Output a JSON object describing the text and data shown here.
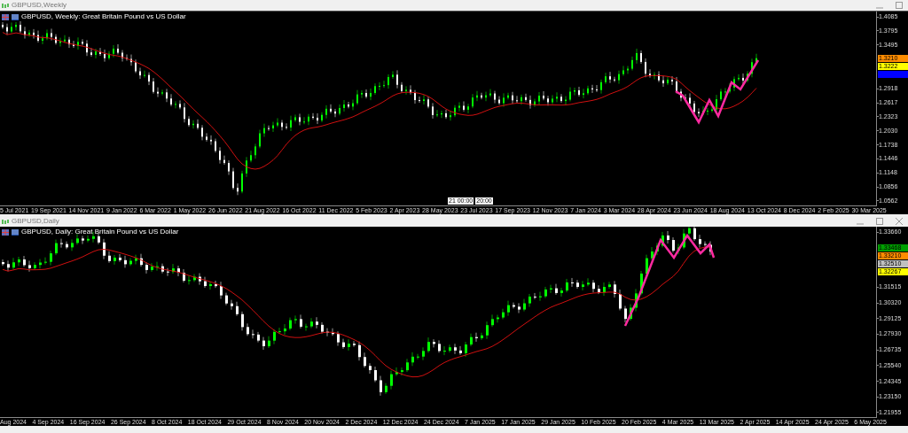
{
  "windows": [
    {
      "title": "GBPUSD,Weekly",
      "chart_title": "GBPUSD, Weekly:  Great Britain Pound vs US Dollar",
      "price_ticks": [
        "1.4085",
        "1.3795",
        "1.3495",
        "1.2918",
        "1.2617",
        "1.2323",
        "1.2030",
        "1.1738",
        "1.1446",
        "1.1148",
        "1.0856",
        "1.0562"
      ],
      "price_markers": [
        {
          "label": "1.3210",
          "color": "#ff8c00"
        },
        {
          "label": "1.3222",
          "color": "#ffff00"
        },
        {
          "color": "#0000ff"
        }
      ],
      "dates": [
        "5 Jul 2021",
        "19 Sep 2021",
        "14 Nov 2021",
        "9 Jan 2022",
        "6 Mar 2022",
        "1 May 2022",
        "26 Jun 2022",
        "21 Aug 2022",
        "16 Oct 2022",
        "11 Dec 2022",
        "5 Feb 2023",
        "2 Apr 2023",
        "28 May 2023",
        "23 Jul 2023",
        "17 Sep 2023",
        "12 Nov 2023",
        "7 Jan 2024",
        "3 Mar 2024",
        "28 Apr 2024",
        "23 Jun 2024",
        "18 Aug 2024",
        "13 Oct 2024",
        "8 Dec 2024",
        "2 Feb 2025",
        "30 Mar 2025"
      ],
      "crosshair_labels": [
        "21 00:00",
        "20:00"
      ]
    },
    {
      "title": "GBPUSD,Daily",
      "chart_title": "GBPUSD, Daily:  Great Britain Pound vs US Dollar",
      "price_ticks": [
        "1.33660",
        "1.31515",
        "1.30320",
        "1.29125",
        "1.27930",
        "1.26735",
        "1.25540",
        "1.24345",
        "1.23150",
        "1.21955"
      ],
      "price_markers": [
        {
          "label": "1.33468",
          "color": "#00a000"
        },
        {
          "label": "1.33210",
          "color": "#ff8c00"
        },
        {
          "label": "1.32510",
          "color": "#c0c0c0"
        },
        {
          "label": "1.32267",
          "color": "#ffff00"
        }
      ],
      "dates": [
        "Aug 2024",
        "4 Sep 2024",
        "16 Sep 2024",
        "26 Sep 2024",
        "8 Oct 2024",
        "18 Oct 2024",
        "29 Oct 2024",
        "8 Nov 2024",
        "20 Nov 2024",
        "2 Dec 2024",
        "12 Dec 2024",
        "24 Dec 2024",
        "7 Jan 2025",
        "17 Jan 2025",
        "29 Jan 2025",
        "10 Feb 2025",
        "20 Feb 2025",
        "4 Mar 2025",
        "13 Mar 2025",
        "2 Apr 2025",
        "14 Apr 2025",
        "24 Apr 2025",
        "6 May 2025"
      ]
    }
  ]
}
